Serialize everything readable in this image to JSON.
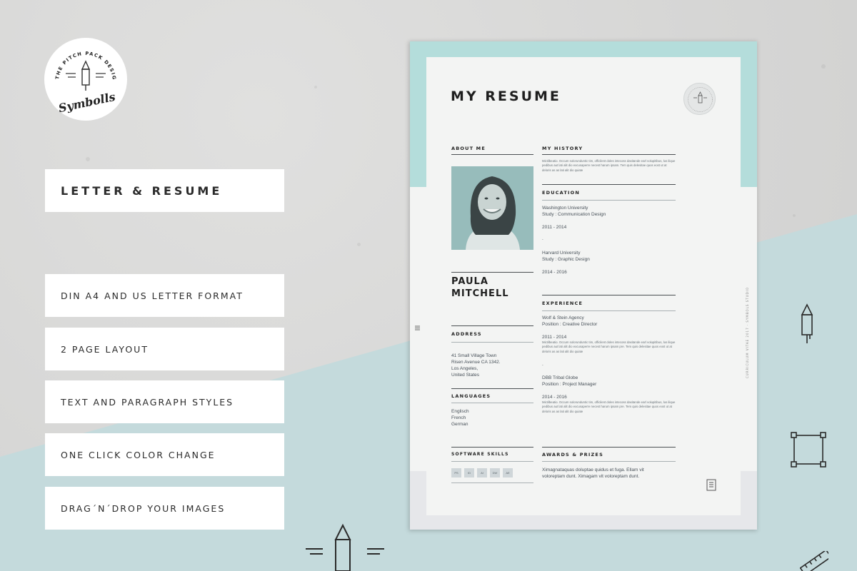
{
  "logo": {
    "ring_text": "THE PITCH PACK DESIGN KIT",
    "script_text": "Symbolls"
  },
  "menu": {
    "title": "LETTER & RESUME",
    "items": [
      {
        "label": "DIN A4 AND US LETTER FORMAT"
      },
      {
        "label": "2 PAGE LAYOUT"
      },
      {
        "label": "TEXT AND PARAGRAPH STYLES"
      },
      {
        "label": "ONE CLICK COLOR CHANGE"
      },
      {
        "label": "DRAG´N´DROP YOUR IMAGES"
      }
    ]
  },
  "resume": {
    "title": "MY RESUME",
    "side_text": "CURRICULUM VITAE 2017 · SYMBOLS STUDIO",
    "about_heading": "ABOUT ME",
    "name_line1": "PAULA",
    "name_line2": "MITCHELL",
    "address_heading": "ADDRESS",
    "address_lines": [
      "41 Small Village Town",
      "Risen Avenue CA 1342.",
      "Los Angeles,",
      "United States"
    ],
    "languages_heading": "LANGUAGES",
    "languages": [
      "Englisch",
      "French",
      "German"
    ],
    "software_heading": "SOFTWARE SKILLS",
    "software": [
      "PS",
      "ID",
      "AI",
      "DW",
      "AE"
    ],
    "history_heading": "MY HISTORY",
    "history_text": "Mictilbeatio. Occum solorunduntic tim, officilent doles intecoss dasitande earl volupitibus, lus ilique pedibus aut lati alit dio excusaperre necest harum ipsam. Tem quis delesitae quos eost ut at deloris as as lati alit dio quiate",
    "education_heading": "EDUCATION",
    "education": [
      {
        "school": "Washington University",
        "study": "Study : Communication Design",
        "years": "2011 - 2014"
      },
      {
        "school": "Harvard University",
        "study": "Study : Graphic Design",
        "years": "2014 - 2016"
      }
    ],
    "experience_heading": "EXPERIENCE",
    "experience": [
      {
        "company": "Wolf & Stein Agency",
        "position": "Position : Creative Director",
        "years": "2011 - 2014",
        "text": "Mictilbeatio. Occum solorunduntic tim, officilent doles intecoss dasitande earl volupitibus, lus ilique pedibus aut lati alit dio excusaperre necest harum ipsam pre. Tem quis delesitae quos eost ut at deloris as as lati alit dio quiate"
      },
      {
        "company": "DBB Tribal Globe",
        "position": "Position : Project Manager",
        "years": "2014 - 2016",
        "text": "Mictilbeatio. Occum solorunduntic tim, officilent doles intecoss dasitande earl volupitibus, lus ilique pedibus aut lati alit dio excusaperre necest harum ipsam pre. Tem quis delesitae quos eost ut at deloris as as lati alit dio quiate"
      }
    ],
    "awards_heading": "AWARDS & PRIZES",
    "awards_text_1": "Ximagnataquas doluptae quidus et fuga. Ellam vit",
    "awards_text_2": "voloreptam dunt. Ximagam vit voloreptam dunt.",
    "dot": "."
  },
  "colors": {
    "accent_teal": "#b4dddb",
    "background_teal": "#c4dadc",
    "background_grey": "#d6d6d5",
    "text_dark": "#1e1e1e"
  },
  "icons": [
    "pencil-icon",
    "crop-frame-icon",
    "ruler-icon",
    "document-icon",
    "menu-lines-icon"
  ]
}
